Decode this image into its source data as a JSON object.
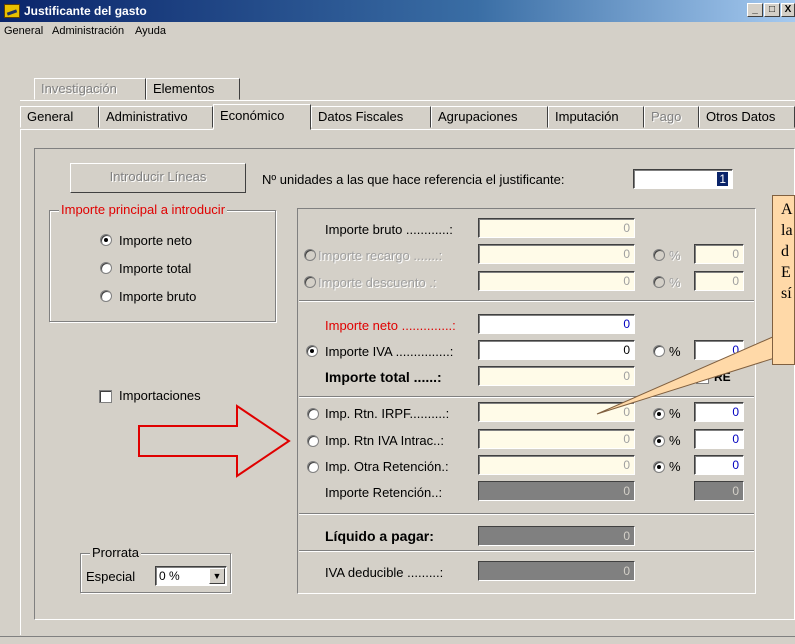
{
  "window": {
    "title": "Justificante del gasto",
    "controls": [
      "_",
      "□",
      "X"
    ]
  },
  "menu": [
    "General",
    "Administración",
    "Ayuda"
  ],
  "tabs_row1": [
    {
      "label": "Investigación",
      "disabled": true
    },
    {
      "label": "Elementos",
      "disabled": false
    }
  ],
  "tabs_row2": [
    {
      "label": "General",
      "disabled": false
    },
    {
      "label": "Administrativo",
      "disabled": false
    },
    {
      "label": "Económico",
      "disabled": false,
      "active": true
    },
    {
      "label": "Datos Fiscales",
      "disabled": false
    },
    {
      "label": "Agrupaciones",
      "disabled": false
    },
    {
      "label": "Imputación",
      "disabled": false
    },
    {
      "label": "Pago",
      "disabled": true
    },
    {
      "label": "Otros Datos",
      "disabled": false
    }
  ],
  "introducir_button": "Introducir Líneas",
  "unidades": {
    "label": "Nº unidades a las que hace referencia el justificante:",
    "value": "1"
  },
  "importe_principal": {
    "legend": "Importe principal a introducir",
    "options": [
      "Importe neto",
      "Importe total",
      "Importe bruto"
    ],
    "selected": "Importe neto"
  },
  "importaciones_label": "Importaciones",
  "prorrata": {
    "legend": "Prorrata",
    "label": "Especial",
    "value": "0 %"
  },
  "rows": {
    "bruto": {
      "label": "Importe bruto ............:",
      "value": "0"
    },
    "recargo": {
      "label": "Importe recargo .......:",
      "value": "0",
      "pct": "0"
    },
    "descuento": {
      "label": "Importe descuento .:",
      "value": "0",
      "pct": "0"
    },
    "neto": {
      "label": "Importe neto ..............:",
      "value": "0"
    },
    "iva": {
      "label": "Importe IVA ...............:",
      "value": "0",
      "pct": "0"
    },
    "total": {
      "label": "Importe total ......:",
      "value": "0",
      "re_label": "RE"
    },
    "irpf": {
      "label": "Imp. Rtn. IRPF..........:",
      "value": "0",
      "pct": "0"
    },
    "iva_intrac": {
      "label": "Imp. Rtn IVA Intrac..:",
      "value": "0",
      "pct": "0"
    },
    "otra": {
      "label": "Imp. Otra Retención.:",
      "value": "0",
      "pct": "0"
    },
    "retencion": {
      "label": "Importe Retención..:",
      "value": "0",
      "pct": "0"
    },
    "liquido": {
      "label": "Líquido a pagar:",
      "value": "0"
    },
    "iva_deducible": {
      "label": "IVA deducible .........:",
      "value": "0"
    }
  },
  "pct_symbol": "%",
  "callout_text": [
    "A",
    "la",
    "d",
    "E",
    "sí"
  ],
  "colors": {
    "arrow": "#e00000",
    "callout_fill": "#ffd9a8",
    "title_bar": "#0a246a"
  }
}
